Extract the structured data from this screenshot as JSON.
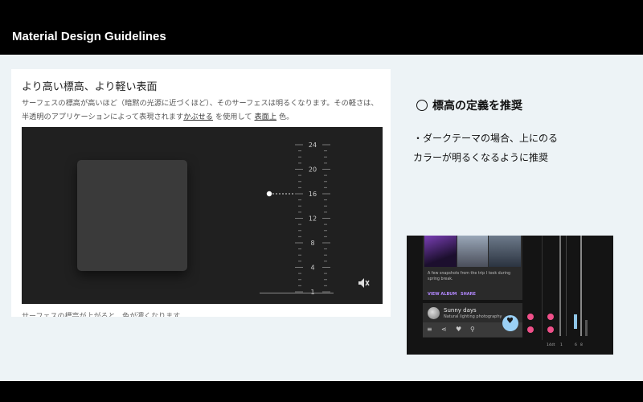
{
  "header": {
    "title": "Material Design Guidelines"
  },
  "doc": {
    "heading": "より高い標高、より軽い表面",
    "body_intro": "サーフェスの標高が高いほど（暗黙の光源に近づくほど）、そのサーフェスは明るくなります。その軽さは、半透明のアプリケーションによって表現されます",
    "link1": "かぶせる",
    "body_mid": " を使用して ",
    "link2": "表面上",
    "body_end": " 色。",
    "cut_text": "サーフェスの標高が上がると、色が濃くなります",
    "ruler_labels": [
      "24",
      "20",
      "16",
      "12",
      "8",
      "4",
      "1"
    ],
    "selected_elevation": 16
  },
  "recommendation": {
    "title": "標高の定義を推奨",
    "line1": "・ダークテーマの場合、上にのる",
    "line2": "カラーが明るくなるように推奨"
  },
  "screenshot": {
    "card_text": "A few snapshots from the trip I took during spring break.",
    "view_album": "VIEW ALBUM",
    "share": "SHARE",
    "sunny_title": "Sunny days",
    "sunny_sub": "Natural lighting photography",
    "scale_labels": [
      "14dt",
      "1",
      "6",
      "8"
    ],
    "pink_markers": [
      "4",
      "4",
      "8",
      "6"
    ]
  },
  "colors": {
    "slide_bg": "#edf3f6",
    "demo_bg": "#202020",
    "surface": "#3a3a3a",
    "accent_purple": "#b388ff",
    "marker_pink": "#f0508a",
    "fab_blue": "#9ad0f5"
  },
  "icons": [
    "mute-icon",
    "menu-icon",
    "share-icon",
    "heart-icon",
    "search-icon",
    "heart-fab-icon"
  ]
}
